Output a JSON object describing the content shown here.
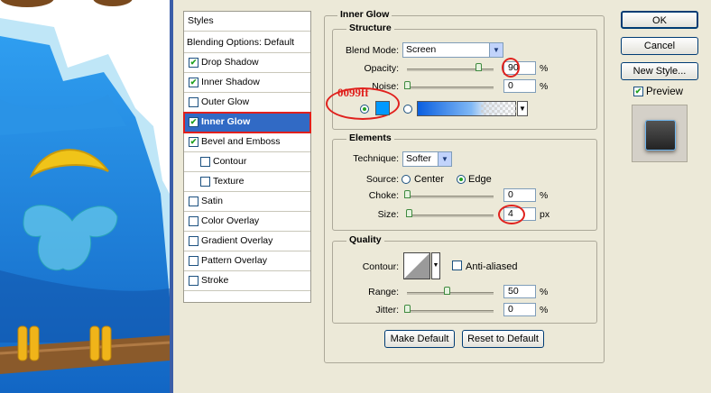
{
  "styles_list": {
    "header": "Styles",
    "items": [
      {
        "label": "Blending Options: Default",
        "checkbox": false,
        "checked": false,
        "indent": false
      },
      {
        "label": "Drop Shadow",
        "checkbox": true,
        "checked": true,
        "indent": false
      },
      {
        "label": "Inner Shadow",
        "checkbox": true,
        "checked": true,
        "indent": false
      },
      {
        "label": "Outer Glow",
        "checkbox": true,
        "checked": false,
        "indent": false
      },
      {
        "label": "Inner Glow",
        "checkbox": true,
        "checked": true,
        "indent": false,
        "selected": true
      },
      {
        "label": "Bevel and Emboss",
        "checkbox": true,
        "checked": true,
        "indent": false
      },
      {
        "label": "Contour",
        "checkbox": true,
        "checked": false,
        "indent": true
      },
      {
        "label": "Texture",
        "checkbox": true,
        "checked": false,
        "indent": true
      },
      {
        "label": "Satin",
        "checkbox": true,
        "checked": false,
        "indent": false
      },
      {
        "label": "Color Overlay",
        "checkbox": true,
        "checked": false,
        "indent": false
      },
      {
        "label": "Gradient Overlay",
        "checkbox": true,
        "checked": false,
        "indent": false
      },
      {
        "label": "Pattern Overlay",
        "checkbox": true,
        "checked": false,
        "indent": false
      },
      {
        "label": "Stroke",
        "checkbox": true,
        "checked": false,
        "indent": false
      }
    ]
  },
  "inner_glow": {
    "title": "Inner Glow",
    "structure": {
      "title": "Structure",
      "blend_mode_label": "Blend Mode:",
      "blend_mode_value": "Screen",
      "opacity_label": "Opacity:",
      "opacity_value": "90",
      "opacity_level": 0.9,
      "noise_label": "Noise:",
      "noise_value": "0",
      "noise_level": 0,
      "percent": "%",
      "color_annotation": "0099ff",
      "glow_color": "#0099ff"
    },
    "elements": {
      "title": "Elements",
      "technique_label": "Technique:",
      "technique_value": "Softer",
      "source_label": "Source:",
      "source_center": "Center",
      "source_edge": "Edge",
      "choke_label": "Choke:",
      "choke_value": "0",
      "choke_level": 0,
      "size_label": "Size:",
      "size_value": "4",
      "size_level": 0.02,
      "percent": "%",
      "px": "px"
    },
    "quality": {
      "title": "Quality",
      "contour_label": "Contour:",
      "anti_aliased": "Anti-aliased",
      "range_label": "Range:",
      "range_value": "50",
      "range_level": 0.5,
      "jitter_label": "Jitter:",
      "jitter_value": "0",
      "jitter_level": 0,
      "percent": "%"
    },
    "make_default": "Make Default",
    "reset_default": "Reset to Default"
  },
  "buttons": {
    "ok": "OK",
    "cancel": "Cancel",
    "new_style": "New Style...",
    "preview": "Preview"
  },
  "colors": {
    "accent_red": "#e0211d",
    "selection": "#316ac5",
    "bird_blue": "#1a7fd9",
    "beak_yellow": "#f0c419"
  }
}
